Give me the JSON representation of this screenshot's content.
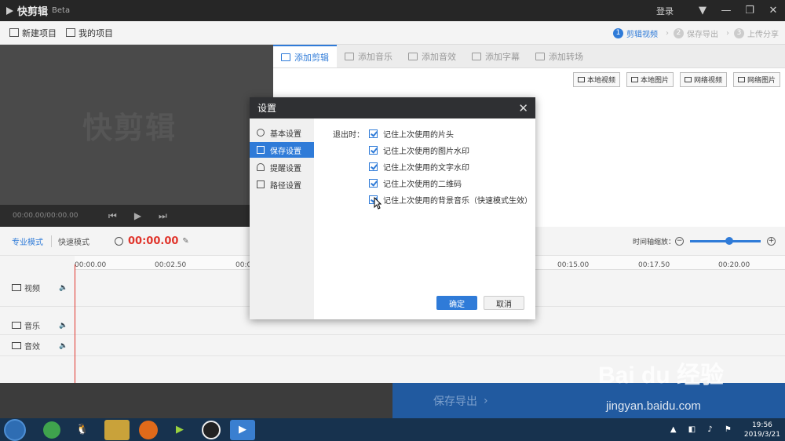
{
  "titlebar": {
    "app_name": "快剪辑",
    "beta": "Beta",
    "login": "登录"
  },
  "toolbar": {
    "new_project": "新建项目",
    "my_projects": "我的项目",
    "steps": [
      {
        "num": "1",
        "label": "剪辑视频"
      },
      {
        "num": "2",
        "label": "保存导出"
      },
      {
        "num": "3",
        "label": "上传分享"
      }
    ]
  },
  "preview": {
    "logo_text": "快剪辑",
    "time": "00:00.00/00:00.00"
  },
  "tabs": [
    "添加剪辑",
    "添加音乐",
    "添加音效",
    "添加字幕",
    "添加转场"
  ],
  "media_buttons": [
    "本地视频",
    "本地图片",
    "网络视频",
    "网络图片"
  ],
  "timeline": {
    "mode_pro": "专业模式",
    "mode_fast": "快速模式",
    "timecode": "00:00.00",
    "zoom_label": "时间轴缩放：",
    "ticks": [
      "00:00.00",
      "00:02.50",
      "00:0",
      "00:15.00",
      "00:17.50",
      "00:20.00"
    ],
    "tracks": [
      "视频",
      "音乐",
      "音效"
    ]
  },
  "export": {
    "label": "保存导出"
  },
  "dialog": {
    "title": "设置",
    "side": [
      "基本设置",
      "保存设置",
      "提醒设置",
      "路径设置"
    ],
    "exit_label": "退出时：",
    "options": [
      "记住上次使用的片头",
      "记住上次使用的图片水印",
      "记住上次使用的文字水印",
      "记住上次使用的二维码",
      "记住上次使用的背景音乐（快速模式生效）"
    ],
    "ok": "确定",
    "cancel": "取消"
  },
  "watermark": {
    "main": "Bai du 经验",
    "sub": "jingyan.baidu.com"
  },
  "taskbar": {
    "time": "19:56",
    "date": "2019/3/21"
  },
  "colors": {
    "accent": "#2f7bd8",
    "timecode": "#e0342b",
    "export_bg": "#215aa0"
  }
}
